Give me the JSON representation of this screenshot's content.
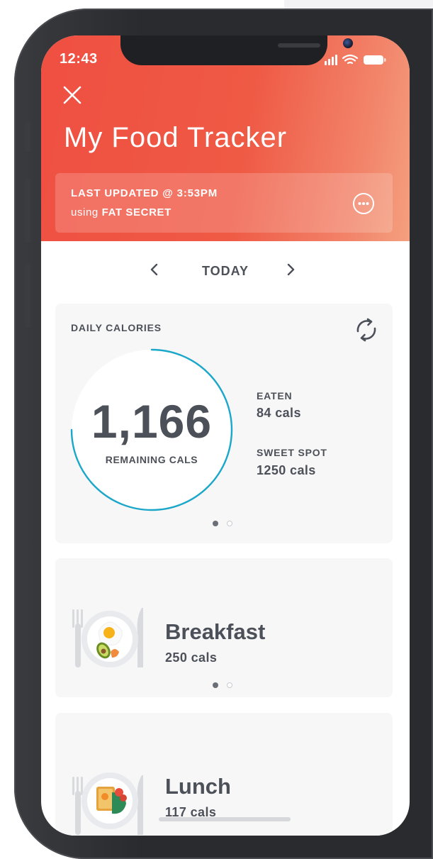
{
  "status_bar": {
    "time": "12:43"
  },
  "header": {
    "title": "My Food Tracker",
    "last_updated_label": "LAST UPDATED @ 3:53PM",
    "source_prefix": "using ",
    "source_name": "FAT SECRET"
  },
  "date_nav": {
    "label": "TODAY"
  },
  "daily_calories": {
    "title": "DAILY CALORIES",
    "remaining_value": "1,166",
    "remaining_label": "REMAINING CALS",
    "eaten_label": "EATEN",
    "eaten_value": "84 cals",
    "sweet_spot_label": "SWEET SPOT",
    "sweet_spot_value": "1250 cals",
    "ring_progress": 0.75,
    "page_count": 2,
    "active_page": 0
  },
  "meals": [
    {
      "name": "Breakfast",
      "cals": "250 cals"
    },
    {
      "name": "Lunch",
      "cals": "117 cals"
    }
  ],
  "colors": {
    "header_start": "#ef4f41",
    "header_end": "#f4a07f",
    "ring": "#1aa7c9",
    "text": "#4c5058"
  }
}
